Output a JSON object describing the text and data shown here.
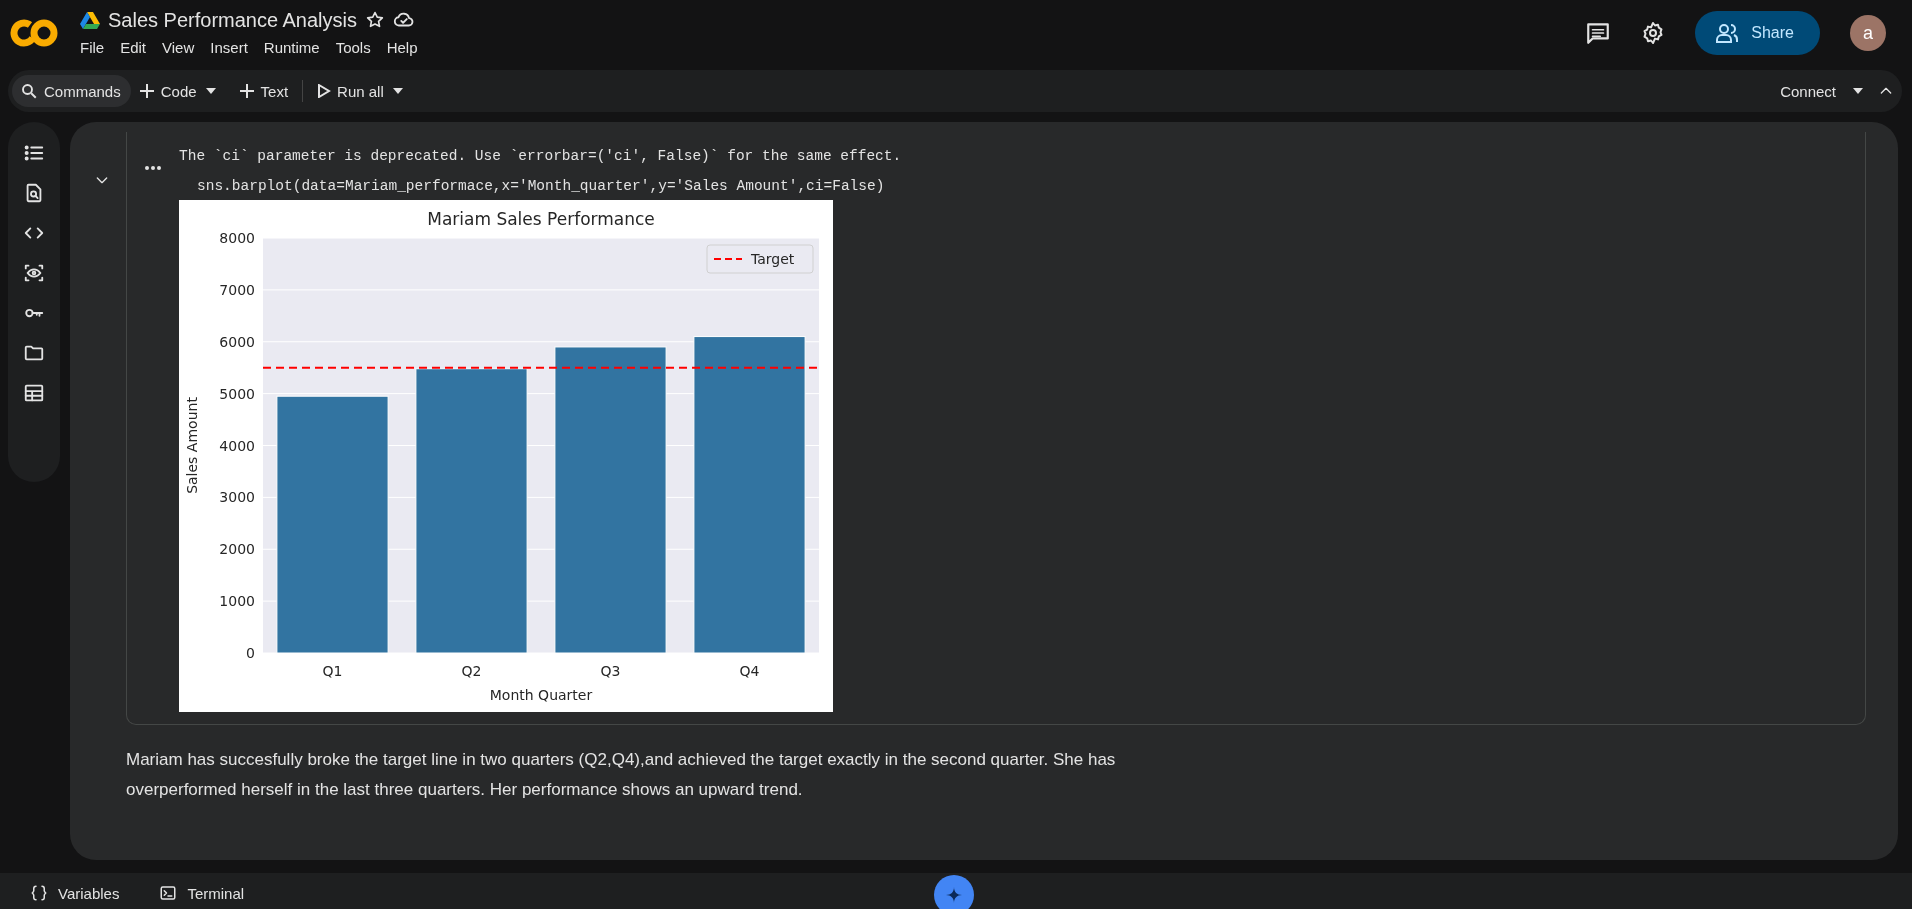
{
  "header": {
    "title": "Sales Performance Analysis",
    "menu": [
      "File",
      "Edit",
      "View",
      "Insert",
      "Runtime",
      "Tools",
      "Help"
    ],
    "share": "Share",
    "avatar": "a"
  },
  "toolbar": {
    "commands": "Commands",
    "code": "Code",
    "text": "Text",
    "run_all": "Run all",
    "connect": "Connect"
  },
  "output_cell": {
    "warning": "The `ci` parameter is deprecated. Use `errorbar=('ci', False)` for the same effect.",
    "code_line": "sns.barplot(data=Mariam_performace,x='Month_quarter',y='Sales Amount',ci=False)",
    "chart_data": {
      "type": "bar",
      "title": "Mariam Sales Performance",
      "xlabel": "Month Quarter",
      "ylabel": "Sales Amount",
      "categories": [
        "Q1",
        "Q2",
        "Q3",
        "Q4"
      ],
      "series": [
        {
          "color": "#3274a1",
          "values": [
            4950,
            5480,
            5900,
            6100
          ]
        }
      ],
      "grid": true,
      "ylim": [
        0,
        8000
      ],
      "yticks": [
        0,
        1000,
        2000,
        3000,
        4000,
        5000,
        6000,
        7000,
        8000
      ],
      "ref_lines": [
        {
          "axis": "y",
          "value": 5500,
          "label": "Target",
          "color": "#ff0000"
        }
      ]
    }
  },
  "text_cell": "Mariam has succesfully broke the target line in two quarters (Q2,Q4),and achieved the target exactly in the second quarter. She has overperformed herself in the last three quarters. Her performance shows an upward trend.",
  "status_bar": [
    {
      "kind": "variables",
      "label": "Variables"
    },
    {
      "kind": "terminal",
      "label": "Terminal"
    }
  ]
}
